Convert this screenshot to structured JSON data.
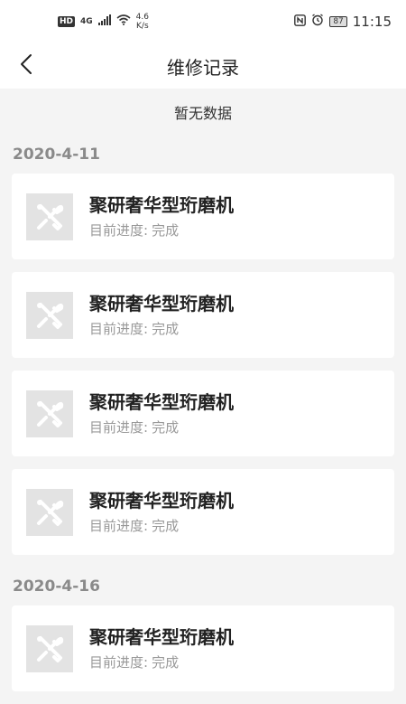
{
  "status_bar": {
    "hd": "HD",
    "network": "4G",
    "net_speed_value": "4.6",
    "net_speed_unit": "K/s",
    "battery": "87",
    "time": "11:15"
  },
  "header": {
    "title": "维修记录"
  },
  "empty_note": "暂无数据",
  "groups": [
    {
      "date": "2020-4-11",
      "items": [
        {
          "title": "聚研奢华型珩磨机",
          "progress_label": "目前进度:",
          "progress_value": "完成"
        },
        {
          "title": "聚研奢华型珩磨机",
          "progress_label": "目前进度:",
          "progress_value": "完成"
        },
        {
          "title": "聚研奢华型珩磨机",
          "progress_label": "目前进度:",
          "progress_value": "完成"
        },
        {
          "title": "聚研奢华型珩磨机",
          "progress_label": "目前进度:",
          "progress_value": "完成"
        }
      ]
    },
    {
      "date": "2020-4-16",
      "items": [
        {
          "title": "聚研奢华型珩磨机",
          "progress_label": "目前进度:",
          "progress_value": "完成"
        }
      ]
    }
  ],
  "icons": {
    "back": "chevron-left-icon",
    "item_thumb": "tools-icon"
  },
  "colors": {
    "background": "#f4f4f4",
    "card": "#ffffff",
    "date_text": "#8a8a8a",
    "thumb_bg": "#e3e3e3"
  }
}
